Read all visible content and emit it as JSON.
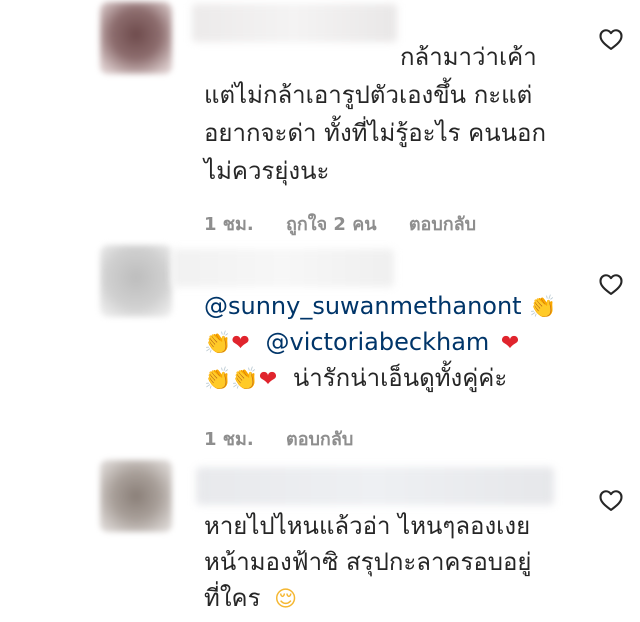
{
  "comments": [
    {
      "lines": [
        "กล้ามาว่าเค้า",
        "แต่ไม่กล้าเอารูปตัวเองขึ้น กะแต่",
        "อยากจะด่า ทั้งที่ไม่รู้อะไร คนนอก",
        "ไม่ควรยุ่งนะ"
      ],
      "time": "1 ชม.",
      "likes": "ถูกใจ 2 คน",
      "reply": "ตอบกลับ"
    },
    {
      "mention1": "@sunny_suwanmethanont",
      "mention2": "@victoriabeckham",
      "line3_text": "น่ารักน่าเอ็นดูทั้งคู่ค่ะ",
      "time": "1 ชม.",
      "reply": "ตอบกลับ"
    },
    {
      "lines": [
        "หายไปไหนแล้วอ่า ไหนๆลองเงย",
        "หน้ามองฟ้าซิ สรุปกะลาครอบอยู่",
        "ที่ใคร"
      ]
    }
  ],
  "icons": {
    "like": "heart-outline-icon",
    "clap": "clapping-hands-emoji",
    "red_heart": "red-heart-emoji",
    "relieved": "relieved-face-emoji"
  },
  "colors": {
    "text": "#262626",
    "meta": "#8e8e8e",
    "mention": "#003569",
    "red_heart": "#e0242d",
    "clap": "#f5b731"
  }
}
